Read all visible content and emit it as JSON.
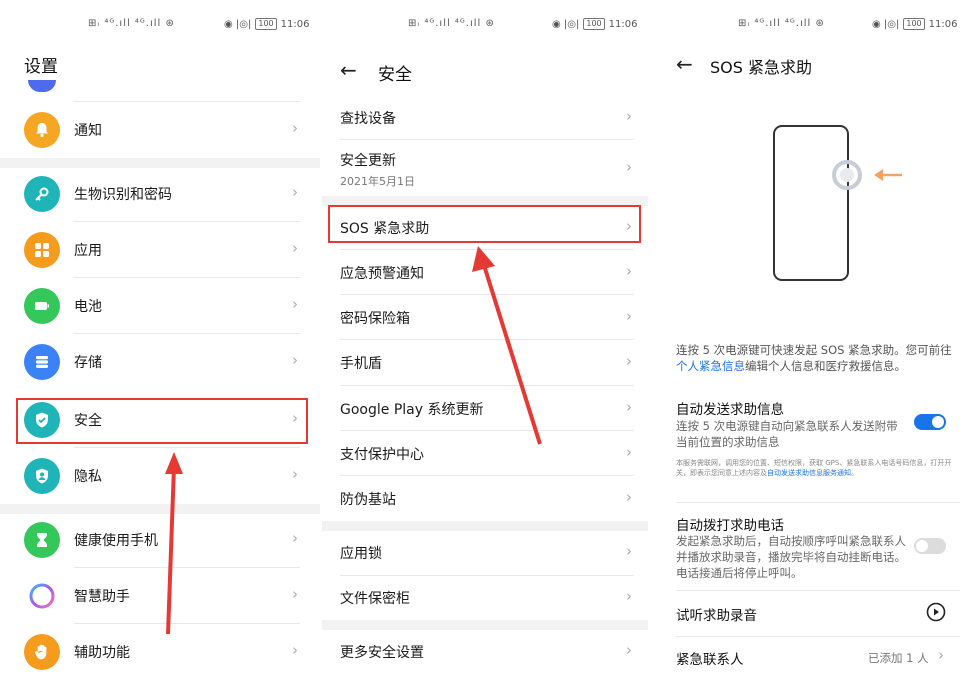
{
  "status": {
    "signal_text": "⊞ᵢ ⁴ᴳ.ıll ⁴ᴳ.ıll ⊛",
    "right_icons": "◉ |◎|",
    "battery": "100",
    "time": "11:06"
  },
  "settings": {
    "title": "设置",
    "items": [
      {
        "label": "通知",
        "icon": "bell-icon",
        "color": "#f5a623"
      },
      {
        "label": "生物识别和密码",
        "icon": "key-icon",
        "color": "#1fb5b8"
      },
      {
        "label": "应用",
        "icon": "grid-icon",
        "color": "#f59b1e"
      },
      {
        "label": "电池",
        "icon": "battery-icon",
        "color": "#34c759"
      },
      {
        "label": "存储",
        "icon": "storage-icon",
        "color": "#3b82f6"
      },
      {
        "label": "安全",
        "icon": "shield-check-icon",
        "color": "#1fb5b8"
      },
      {
        "label": "隐私",
        "icon": "privacy-icon",
        "color": "#1fb5b8"
      },
      {
        "label": "健康使用手机",
        "icon": "hourglass-icon",
        "color": "#34c759"
      },
      {
        "label": "智慧助手",
        "icon": "assistant-ring-icon",
        "color": "#a855f7"
      },
      {
        "label": "辅助功能",
        "icon": "hand-icon",
        "color": "#f59b1e"
      }
    ]
  },
  "security": {
    "title": "安全",
    "items": [
      {
        "label": "查找设备"
      },
      {
        "label": "安全更新",
        "sub": "2021年5月1日"
      },
      {
        "label": "SOS 紧急求助"
      },
      {
        "label": "应急预警通知"
      },
      {
        "label": "密码保险箱"
      },
      {
        "label": "手机盾"
      },
      {
        "label": "Google Play 系统更新"
      },
      {
        "label": "支付保护中心"
      },
      {
        "label": "防伪基站"
      },
      {
        "label": "应用锁"
      },
      {
        "label": "文件保密柜"
      },
      {
        "label": "更多安全设置"
      }
    ]
  },
  "sos": {
    "title": "SOS 紧急求助",
    "desc_before": "连按 5 次电源键可快速发起 SOS 紧急求助。您可前往",
    "desc_link": "个人紧急信息",
    "desc_after": "编辑个人信息和医疗救援信息。",
    "auto_msg_title": "自动发送求助信息",
    "auto_msg_desc": "连按 5 次电源键自动向紧急联系人发送附带当前位置的求助信息",
    "auto_msg_on": true,
    "fine_print_before": "本服务需联网，调用您的位置、短信权限，获取 GPS、紧急联系人电话号码信息，打开开关，即表示您同意上述内容及",
    "fine_print_link": "自动发送求助信息服务通知",
    "fine_print_after": "。",
    "auto_call_title": "自动拨打求助电话",
    "auto_call_desc": "发起紧急求助后，自动按顺序呼叫紧急联系人并播放求助录音，播放完毕将自动挂断电话。电话接通后将停止呼叫。",
    "auto_call_on": false,
    "listen_label": "试听求助录音",
    "contacts_label": "紧急联系人",
    "contacts_value": "已添加 1 人"
  },
  "colors": {
    "accent": "#1a73e8",
    "toggle_on": "#1a73e8",
    "toggle_off": "#d8d8d8",
    "highlight": "#e53935"
  }
}
